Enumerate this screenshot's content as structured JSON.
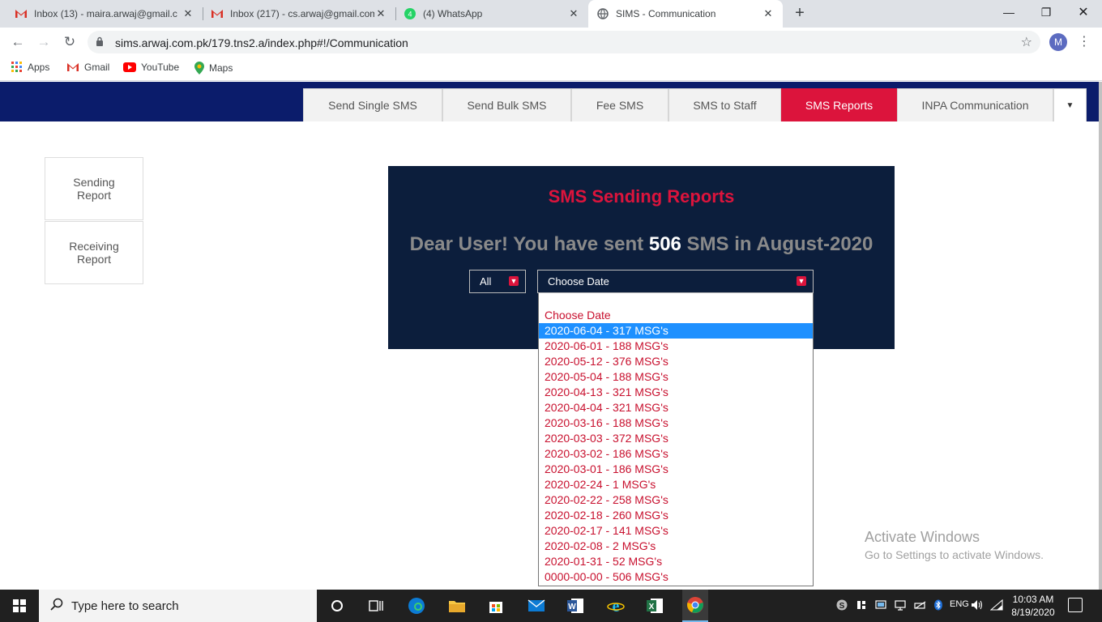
{
  "browser": {
    "tabs": [
      {
        "title": "Inbox (13) - maira.arwaj@gmail.c",
        "icon": "gmail-icon"
      },
      {
        "title": "Inbox (217) - cs.arwaj@gmail.com",
        "icon": "gmail-icon"
      },
      {
        "title": "(4) WhatsApp",
        "icon": "whatsapp-icon"
      },
      {
        "title": "SIMS - Communication",
        "icon": "globe-icon"
      }
    ],
    "url": "sims.arwaj.com.pk/179.tns2.a/index.php#!/Communication",
    "profile_initial": "M",
    "bookmarks": [
      {
        "label": "Apps",
        "icon": "apps-grid-icon"
      },
      {
        "label": "Gmail",
        "icon": "gmail-icon"
      },
      {
        "label": "YouTube",
        "icon": "youtube-icon"
      },
      {
        "label": "Maps",
        "icon": "maps-pin-icon"
      }
    ]
  },
  "nav": {
    "tabs": [
      "Send Single SMS",
      "Send Bulk SMS",
      "Fee SMS",
      "SMS to Staff",
      "SMS Reports",
      "INPA Communication"
    ],
    "active": "SMS Reports"
  },
  "sidebar": {
    "sending_line1": "Sending",
    "sending_line2": "Report",
    "receiving_line1": "Receiving",
    "receiving_line2": "Report"
  },
  "panel": {
    "title": "SMS Sending Reports",
    "message_prefix": "Dear User! You have sent ",
    "count": "506",
    "message_suffix": " SMS in August-2020",
    "filter_value": "All",
    "date_value": "Choose Date"
  },
  "date_options": [
    "Choose Date",
    "2020-06-04 - 317 MSG's",
    "2020-06-01 - 188 MSG's",
    "2020-05-12 - 376 MSG's",
    "2020-05-04 - 188 MSG's",
    "2020-04-13 - 321 MSG's",
    "2020-04-04 - 321 MSG's",
    "2020-03-16 - 188 MSG's",
    "2020-03-03 - 372 MSG's",
    "2020-03-02 - 186 MSG's",
    "2020-03-01 - 186 MSG's",
    "2020-02-24 - 1 MSG's",
    "2020-02-22 - 258 MSG's",
    "2020-02-18 - 260 MSG's",
    "2020-02-17 - 141 MSG's",
    "2020-02-08 - 2 MSG's",
    "2020-01-31 - 52 MSG's",
    "0000-00-00 - 506 MSG's"
  ],
  "highlighted_option": "2020-06-04 - 317 MSG's",
  "watermark": {
    "line1": "Activate Windows",
    "line2": "Go to Settings to activate Windows."
  },
  "taskbar": {
    "search_placeholder": "Type here to search",
    "time": "10:03 AM",
    "date": "8/19/2020"
  },
  "colors": {
    "accent": "#dc143c",
    "panel_bg": "#0c1e3c",
    "header_band": "#0b1c6b",
    "selected_option": "#1e90ff"
  }
}
